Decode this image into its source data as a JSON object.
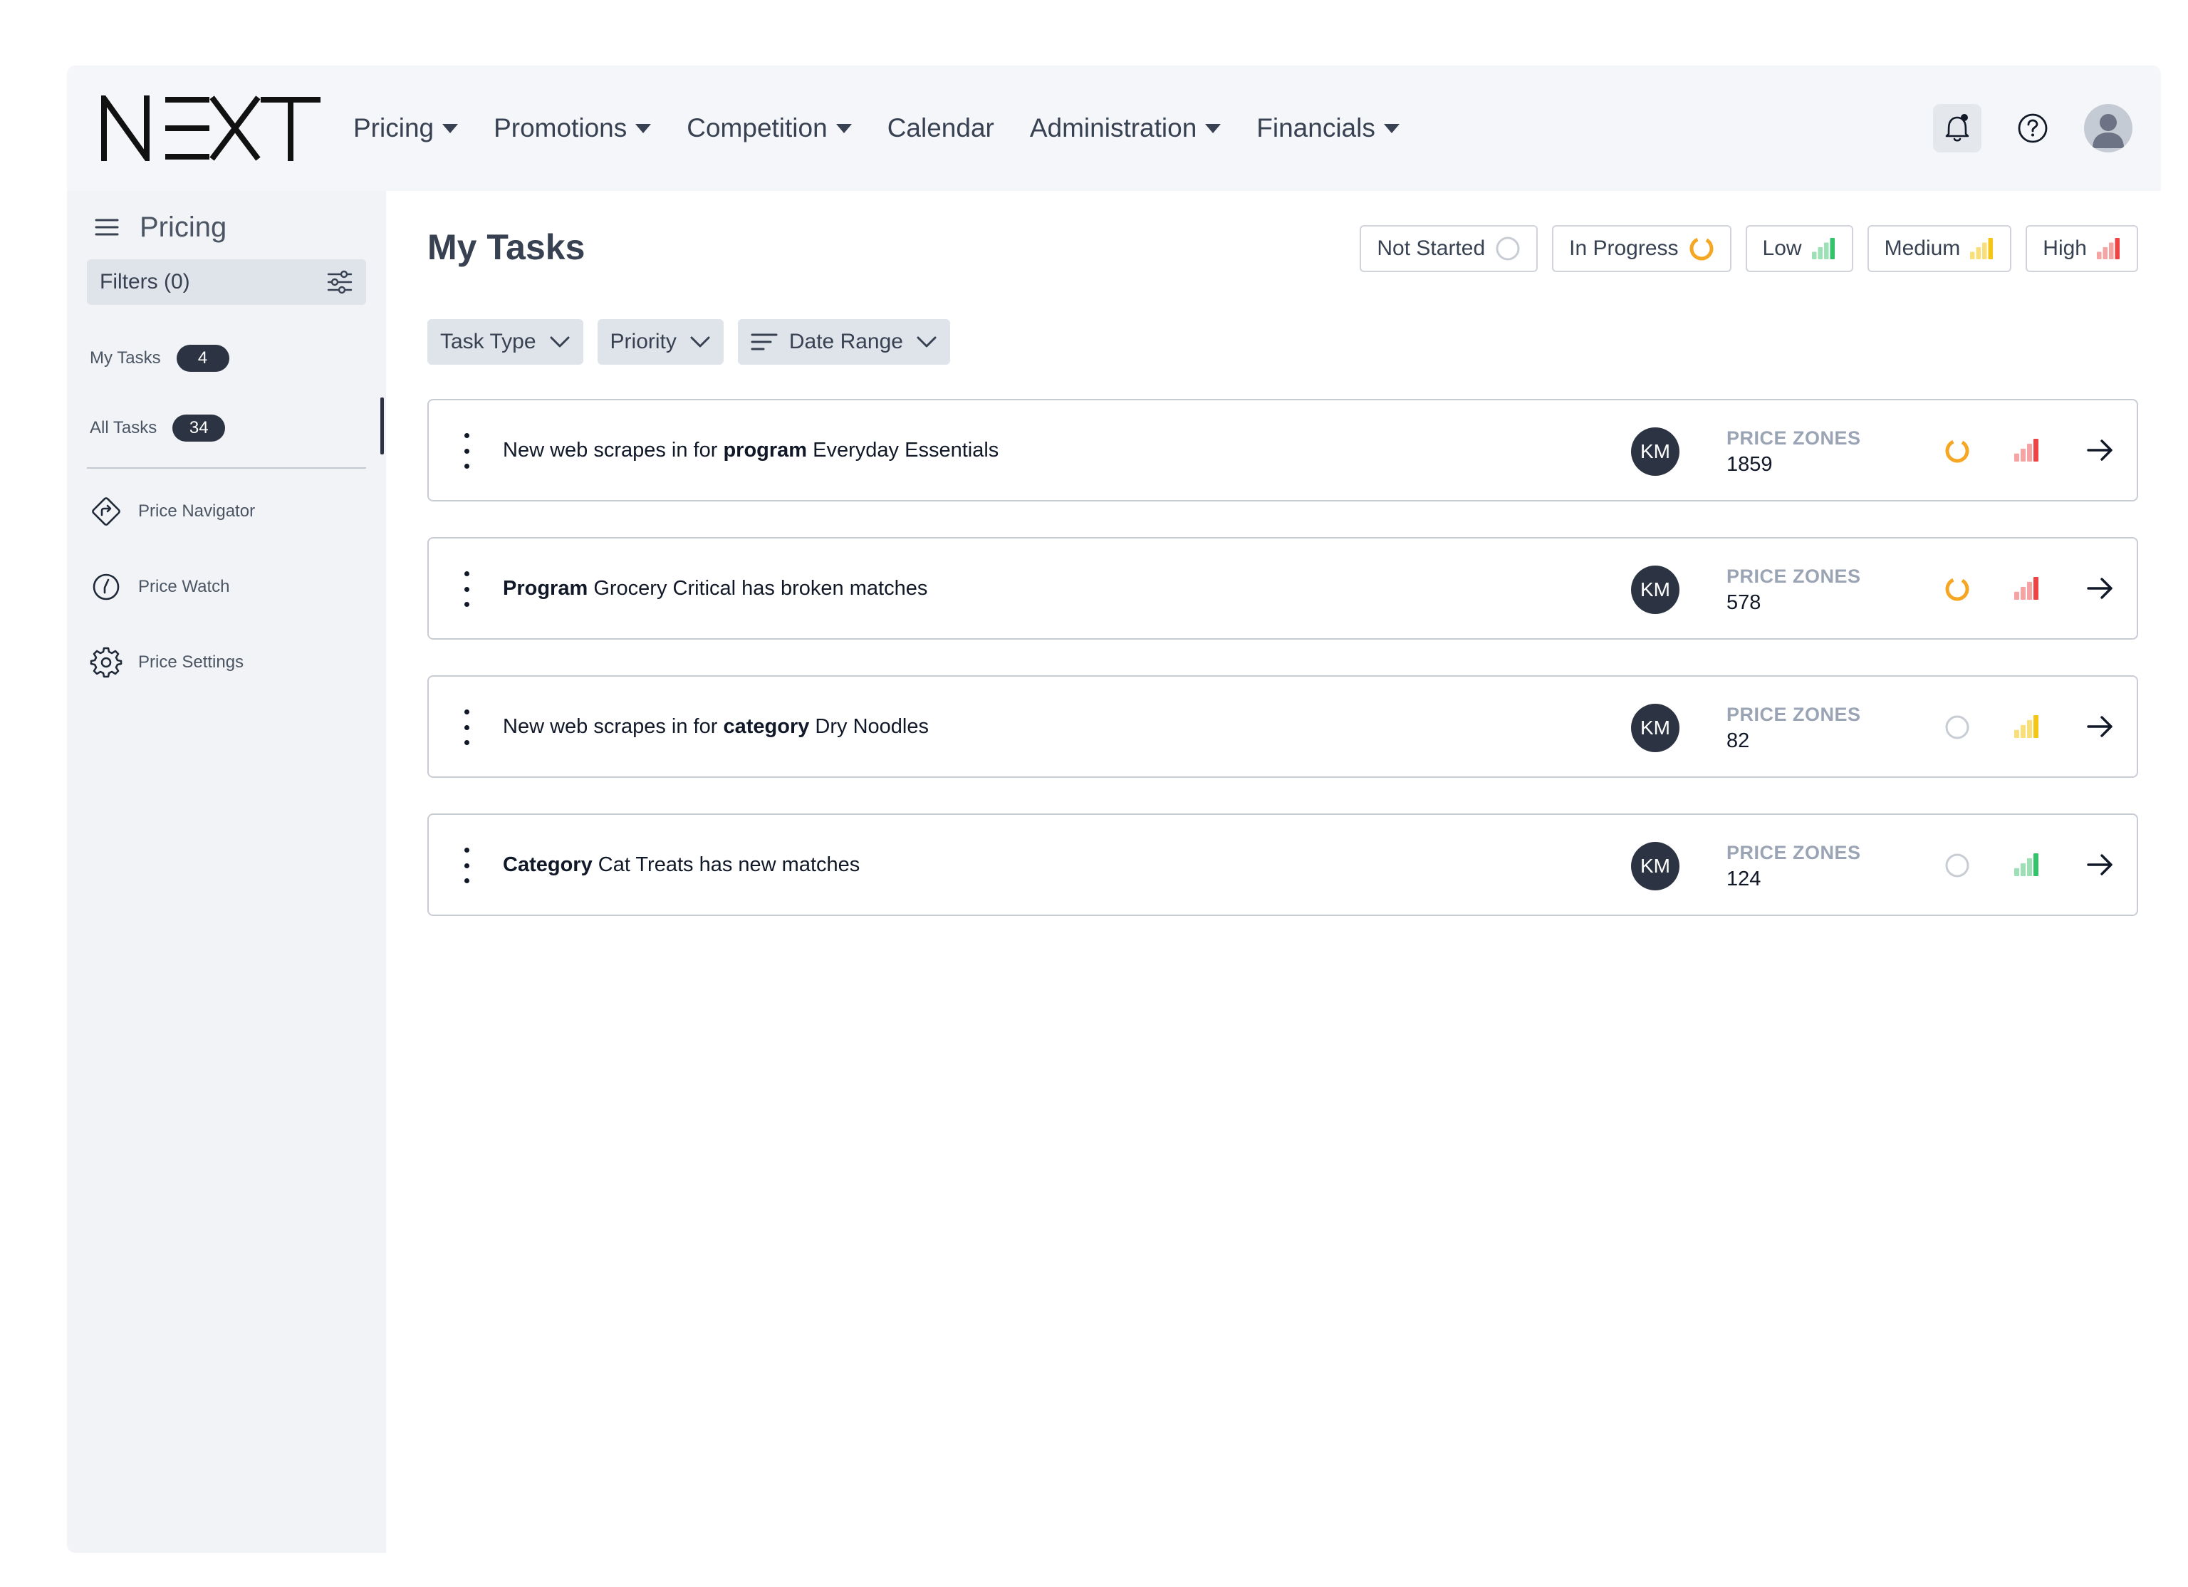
{
  "app": {
    "logo_text": "NEXT"
  },
  "nav": {
    "items": [
      {
        "label": "Pricing",
        "has_dropdown": true
      },
      {
        "label": "Promotions",
        "has_dropdown": true
      },
      {
        "label": "Competition",
        "has_dropdown": true
      },
      {
        "label": "Calendar",
        "has_dropdown": false
      },
      {
        "label": "Administration",
        "has_dropdown": true
      },
      {
        "label": "Financials",
        "has_dropdown": true
      }
    ],
    "icons": [
      "bell-icon",
      "help-icon",
      "user-avatar"
    ]
  },
  "sidebar": {
    "title": "Pricing",
    "filters_label": "Filters (0)",
    "counts": [
      {
        "label": "My Tasks",
        "count": "4",
        "active": true
      },
      {
        "label": "All Tasks",
        "count": "34",
        "active": false
      }
    ],
    "links": [
      {
        "label": "Price Navigator",
        "icon": "navigator-icon"
      },
      {
        "label": "Price Watch",
        "icon": "watch-icon"
      },
      {
        "label": "Price Settings",
        "icon": "gear-icon"
      }
    ]
  },
  "main": {
    "title": "My Tasks",
    "legend": [
      {
        "label": "Not Started",
        "kind": "status-not-started"
      },
      {
        "label": "In Progress",
        "kind": "status-in-progress"
      },
      {
        "label": "Low",
        "kind": "priority-low"
      },
      {
        "label": "Medium",
        "kind": "priority-medium"
      },
      {
        "label": "High",
        "kind": "priority-high"
      }
    ],
    "filters": [
      {
        "label": "Task Type"
      },
      {
        "label": "Priority"
      },
      {
        "label": "Date Range"
      }
    ],
    "zones_label": "PRICE ZONES",
    "tasks": [
      {
        "pre": "New web scrapes in for ",
        "bold": "program",
        "post": " Everyday Essentials",
        "assignee": "KM",
        "zones": "1859",
        "status": "in-progress",
        "priority": "high"
      },
      {
        "pre": "",
        "bold": "Program",
        "post": " Grocery Critical has broken matches",
        "assignee": "KM",
        "zones": "578",
        "status": "in-progress",
        "priority": "high"
      },
      {
        "pre": "New web scrapes in for ",
        "bold": "category",
        "post": " Dry Noodles",
        "assignee": "KM",
        "zones": "82",
        "status": "not-started",
        "priority": "medium"
      },
      {
        "pre": "",
        "bold": "Category",
        "post": " Cat Treats has new matches",
        "assignee": "KM",
        "zones": "124",
        "status": "not-started",
        "priority": "low"
      }
    ]
  },
  "colors": {
    "in_progress": "#f5a623",
    "not_started": "#c8ccd3",
    "priority_high": "#ef4444",
    "priority_high_light": "#f6a3a3",
    "priority_medium": "#f5c518",
    "priority_medium_light": "#f8df7a",
    "priority_low": "#34c26a",
    "priority_low_light": "#9ee0b5",
    "dark": "#2c3342"
  }
}
